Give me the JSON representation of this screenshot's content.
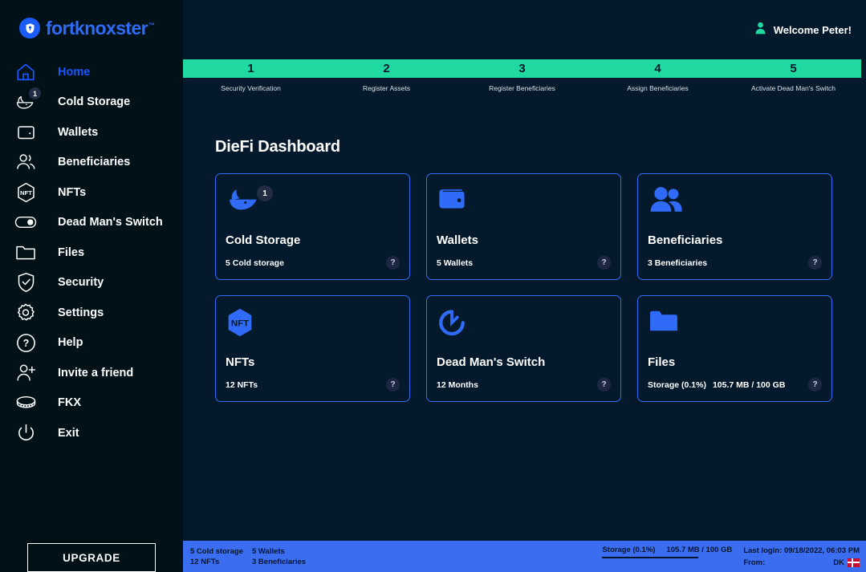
{
  "brand": {
    "name": "fortknoxster",
    "tm": "™",
    "logo_icon": "vault-shield-icon",
    "accent_blue": "#2f6bf7",
    "accent_teal": "#20d9a1"
  },
  "sidebar": {
    "items": [
      {
        "label": "Home",
        "icon": "home-icon",
        "active": true,
        "badge": null
      },
      {
        "label": "Cold Storage",
        "icon": "whale-icon",
        "active": false,
        "badge": "1"
      },
      {
        "label": "Wallets",
        "icon": "wallet-icon",
        "active": false,
        "badge": null
      },
      {
        "label": "Beneficiaries",
        "icon": "users-icon",
        "active": false,
        "badge": null
      },
      {
        "label": "NFTs",
        "icon": "nft-hexagon-icon",
        "active": false,
        "badge": null
      },
      {
        "label": "Dead Man's Switch",
        "icon": "toggle-icon",
        "active": false,
        "badge": null
      },
      {
        "label": "Files",
        "icon": "folder-icon",
        "active": false,
        "badge": null
      },
      {
        "label": "Security",
        "icon": "shield-check-icon",
        "active": false,
        "badge": null
      },
      {
        "label": "Settings",
        "icon": "gear-icon",
        "active": false,
        "badge": null
      },
      {
        "label": "Help",
        "icon": "question-circle-icon",
        "active": false,
        "badge": null
      },
      {
        "label": "Invite a friend",
        "icon": "user-plus-icon",
        "active": false,
        "badge": null
      },
      {
        "label": "FKX",
        "icon": "coin-icon",
        "active": false,
        "badge": null
      },
      {
        "label": "Exit",
        "icon": "power-icon",
        "active": false,
        "badge": null
      }
    ],
    "upgrade_label": "UPGRADE"
  },
  "topbar": {
    "user_icon": "user-avatar-icon",
    "welcome": "Welcome Peter!"
  },
  "steps": [
    {
      "number": "1",
      "label": "Security Verification"
    },
    {
      "number": "2",
      "label": "Register Assets"
    },
    {
      "number": "3",
      "label": "Register Beneficiaries"
    },
    {
      "number": "4",
      "label": "Assign Beneficiaries"
    },
    {
      "number": "5",
      "label": "Activate Dead Man's Switch"
    }
  ],
  "dashboard": {
    "title": "DieFi Dashboard",
    "help_glyph": "?",
    "cards": [
      {
        "title": "Cold Storage",
        "icon": "whale-icon",
        "badge": "1",
        "sub": "5 Cold storage",
        "sub2": ""
      },
      {
        "title": "Wallets",
        "icon": "wallet-icon",
        "badge": null,
        "sub": "5 Wallets",
        "sub2": ""
      },
      {
        "title": "Beneficiaries",
        "icon": "users-icon",
        "badge": null,
        "sub": "3 Beneficiaries",
        "sub2": ""
      },
      {
        "title": "NFTs",
        "icon": "nft-hexagon-icon",
        "badge": null,
        "sub": "12 NFTs",
        "sub2": ""
      },
      {
        "title": "Dead Man's Switch",
        "icon": "clock-icon",
        "badge": null,
        "sub": "12 Months",
        "sub2": ""
      },
      {
        "title": "Files",
        "icon": "folder-icon",
        "badge": null,
        "sub": "Storage (0.1%)",
        "sub2": "105.7 MB / 100 GB"
      }
    ]
  },
  "statusbar": {
    "cold_storage": "5 Cold storage",
    "wallets": "5 Wallets",
    "nfts": "12 NFTs",
    "beneficiaries": "3 Beneficiaries",
    "storage_label": "Storage (0.1%)",
    "storage_value": "105.7 MB / 100 GB",
    "storage_percent": 0.1,
    "last_login": "Last login: 09/18/2022, 06:03 PM",
    "from_label": "From:",
    "country_code": "DK",
    "flag_icon": "denmark-flag-icon"
  }
}
